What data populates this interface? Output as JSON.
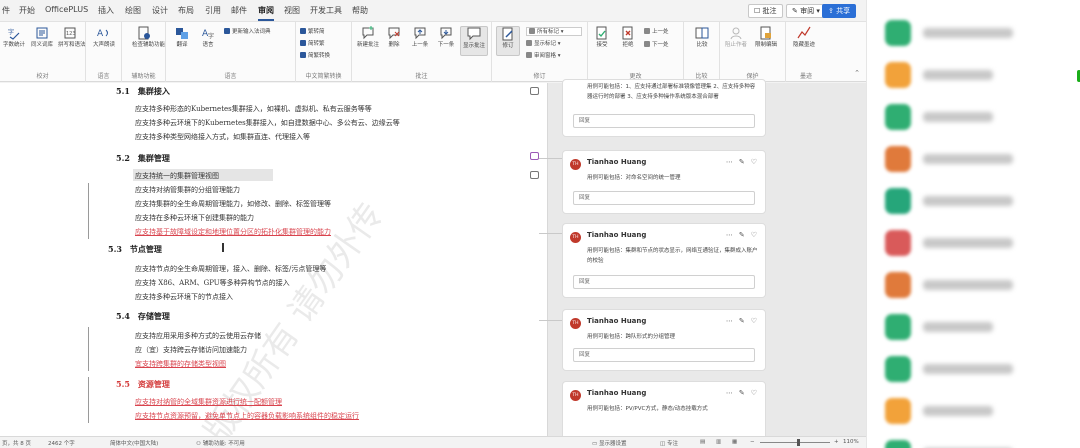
{
  "menubar": {
    "tabs": [
      "件",
      "开始",
      "OfficePLUS",
      "插入",
      "绘图",
      "设计",
      "布局",
      "引用",
      "邮件",
      "审阅",
      "视图",
      "开发工具",
      "帮助"
    ],
    "active_tab": "审阅",
    "comment_button": "批注",
    "edit_button": "审阅",
    "share_button": "共享"
  },
  "ribbon": {
    "groups": [
      {
        "name": "校对",
        "buttons": [
          "字数统计",
          "同义词库",
          "拼写和语法"
        ]
      },
      {
        "name": "语言",
        "buttons": [
          "大声朗读"
        ]
      },
      {
        "name": "辅助功能",
        "buttons": [
          "检查辅助功能"
        ]
      },
      {
        "name": "语言",
        "buttons": [
          "翻译",
          "语言"
        ],
        "extra": "更新输入法词典"
      },
      {
        "name": "中文简繁转换",
        "buttons": [
          "繁转简",
          "简转繁",
          "简繁转换"
        ]
      },
      {
        "name": "批注",
        "buttons": [
          "新建批注",
          "删除",
          "上一条",
          "下一条",
          "显示批注"
        ]
      },
      {
        "name": "修订",
        "buttons": [
          "修订"
        ],
        "options": [
          "所有标记",
          "显示标记",
          "审阅窗格"
        ]
      },
      {
        "name": "更改",
        "buttons": [
          "接受",
          "拒绝"
        ],
        "options": [
          "上一处",
          "下一处"
        ]
      },
      {
        "name": "比较",
        "buttons": [
          "比较"
        ]
      },
      {
        "name": "保护",
        "buttons": [
          "阻止作者",
          "限制编辑"
        ]
      },
      {
        "name": "墨迹",
        "buttons": [
          "隐藏墨迹"
        ]
      }
    ]
  },
  "document": {
    "watermark": "版权所有 请勿外传",
    "sections": [
      {
        "heading": "5.1　集群接入",
        "lines": [
          "应支持多种形态的Kubernetes集群接入，如裸机、虚拟机、私有云服务等等",
          "应支持多种云环境下的Kubernetes集群接入，如自建数据中心、多公有云、边缘云等",
          "应支持多种类型网络接入方式，如集群直连、代理接入等"
        ]
      },
      {
        "heading": "5.2　集群管理",
        "lines": [
          "应支持统一的集群管理视图",
          "应支持对纳管集群的分组管理能力",
          "应支持集群的全生命周期管理能力，如修改、删除、标签管理等",
          "应支持在多种云环境下创建集群的能力",
          "应支持基于故障域设定和地理位置分区的拓扑化集群管理的能力"
        ]
      },
      {
        "heading": "5.3　节点管理",
        "lines": [
          "应支持节点的全生命周期管理，接入、删除、标签/污点管理等",
          "应支持 X86、ARM、GPU等多种异构节点的接入",
          "应支持多种云环境下的节点接入"
        ]
      },
      {
        "heading": "5.4　存储管理",
        "lines": [
          "应支持应用采用多种方式的云使用云存储",
          "应（宜）支持跨云存储访问加速能力",
          "宜支持跨集群的存储类型视图"
        ]
      },
      {
        "heading": "5.5　资源管理",
        "lines": [
          "应支持对纳管的全域集群资源进行统一配额管理",
          "应支持节点资源预留，避免单节点上的容器负载影响系统组件的稳定运行"
        ]
      }
    ]
  },
  "comments": [
    {
      "author": "",
      "text": "用例可能包括：1、应支持通过部署标准镜像管理集 2、应支持多种容器运行时的部署 3、应支持多种操作系统版本混合部署",
      "reply": "回复"
    },
    {
      "author": "Tianhao Huang",
      "text": "用例可能包括：对命名空间的统一管理",
      "reply": "回复"
    },
    {
      "author": "Tianhao Huang",
      "text": "用例可能包括：集群和节点的状态显示，网络互通验证，集群成入账户的校验",
      "reply": "回复"
    },
    {
      "author": "Tianhao Huang",
      "text": "用例可能包括：跨队形式的分组管理",
      "reply": "回复"
    },
    {
      "author": "Tianhao Huang",
      "text": "用例可能包括：PV/PVC方式，静态/动态挂载方式",
      "reply": ""
    }
  ],
  "avatar_initials": "TH",
  "statusbar": {
    "page": "页，共 8 页",
    "words": "2462 个字",
    "lang": "简体中文(中国大陆)",
    "accessibility": "辅助功能: 不可用",
    "display": "显示器设置",
    "focus": "专注",
    "zoom": "110%"
  },
  "colors": {
    "accent": "#2b579a",
    "share_blue": "#2b6fd6",
    "tracked_change_red": "#d9434d",
    "avatar_red": "#c0392b",
    "side_icons": [
      "#2fae72",
      "#f2a23a",
      "#2fae72",
      "#e07a3b",
      "#26a67a",
      "#d95a5a",
      "#e07a3b",
      "#2fae72",
      "#2fae72",
      "#f2a23a",
      "#2fae72",
      "#4b8be0"
    ]
  }
}
